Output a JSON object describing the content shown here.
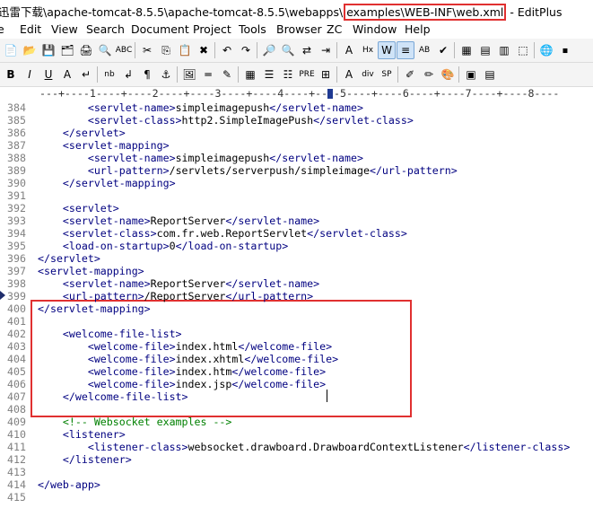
{
  "window": {
    "title_prefix": "迅雷下载\\apache-tomcat-8.5.5\\apache-tomcat-8.5.5\\webapps\\",
    "title_highlight": "examples\\WEB-INF\\web.xml",
    "title_suffix": " - EditPlus"
  },
  "menu": [
    "e",
    "Edit",
    "View",
    "Search",
    "Document",
    "Project",
    "Tools",
    "Browser",
    "ZC",
    "Window",
    "Help"
  ],
  "toolbar1": [
    {
      "name": "new-file-icon",
      "glyph": "📄"
    },
    {
      "name": "open-file-icon",
      "glyph": "📂"
    },
    {
      "name": "save-icon",
      "glyph": "💾"
    },
    {
      "name": "save-all-icon",
      "glyph": "🗂"
    },
    {
      "name": "print-icon",
      "glyph": "🖨"
    },
    {
      "name": "print-preview-icon",
      "glyph": "🔍"
    },
    {
      "name": "spell-check-icon",
      "glyph": "ABC"
    },
    {
      "name": "cut-icon",
      "glyph": "✂"
    },
    {
      "name": "copy-icon",
      "glyph": "⎘"
    },
    {
      "name": "paste-icon",
      "glyph": "📋"
    },
    {
      "name": "delete-icon",
      "glyph": "✖"
    },
    {
      "name": "undo-icon",
      "glyph": "↶"
    },
    {
      "name": "redo-icon",
      "glyph": "↷"
    },
    {
      "name": "find-icon",
      "glyph": "🔎"
    },
    {
      "name": "find-next-icon",
      "glyph": "🔍"
    },
    {
      "name": "replace-icon",
      "glyph": "⇄"
    },
    {
      "name": "indent-icon",
      "glyph": "⇥"
    },
    {
      "name": "font-icon",
      "glyph": "A"
    },
    {
      "name": "hex-icon",
      "glyph": "Hx"
    },
    {
      "name": "word-wrap-icon",
      "glyph": "W"
    },
    {
      "name": "line-number-icon",
      "glyph": "≡"
    },
    {
      "name": "ruler-icon",
      "glyph": "AB"
    },
    {
      "name": "spell-ok-icon",
      "glyph": "✔"
    },
    {
      "name": "directory-window-icon",
      "glyph": "▦"
    },
    {
      "name": "cliptext-icon",
      "glyph": "▤"
    },
    {
      "name": "output-window-icon",
      "glyph": "▥"
    },
    {
      "name": "fullscreen-icon",
      "glyph": "⬚"
    },
    {
      "name": "browser-icon",
      "glyph": "🌐"
    },
    {
      "name": "stop-icon",
      "glyph": "⏹"
    }
  ],
  "toolbar2": [
    {
      "name": "bold-icon",
      "glyph": "B"
    },
    {
      "name": "italic-icon",
      "glyph": "I"
    },
    {
      "name": "underline-icon",
      "glyph": "U"
    },
    {
      "name": "font-color-icon",
      "glyph": "A"
    },
    {
      "name": "line-break-icon",
      "glyph": "↵"
    },
    {
      "name": "nbsp-icon",
      "glyph": "nb"
    },
    {
      "name": "return-icon",
      "glyph": "↲"
    },
    {
      "name": "paragraph-icon",
      "glyph": "¶"
    },
    {
      "name": "anchor-icon",
      "glyph": "⚓"
    },
    {
      "name": "image-icon",
      "glyph": "🖼"
    },
    {
      "name": "horizontal-rule-icon",
      "glyph": "═"
    },
    {
      "name": "comment-icon",
      "glyph": "✎"
    },
    {
      "name": "table-icon",
      "glyph": "▦"
    },
    {
      "name": "form-icon",
      "glyph": "☰"
    },
    {
      "name": "list-icon",
      "glyph": "☷"
    },
    {
      "name": "pre-icon",
      "glyph": "PRE"
    },
    {
      "name": "table-wizard-icon",
      "glyph": "⊞"
    },
    {
      "name": "text-color-icon",
      "glyph": "A"
    },
    {
      "name": "div-icon",
      "glyph": "div"
    },
    {
      "name": "span-icon",
      "glyph": "SP"
    },
    {
      "name": "edit-icon",
      "glyph": "✐"
    },
    {
      "name": "pencil-icon",
      "glyph": "✏"
    },
    {
      "name": "color-picker-icon",
      "glyph": "🎨"
    },
    {
      "name": "view-browser-icon",
      "glyph": "▣"
    },
    {
      "name": "cliptext-panel-icon",
      "glyph": "▤"
    }
  ],
  "ruler": "---+----1----+----2----+----3----+----4----+----5----+----6----+----7----+----8----",
  "lines": [
    {
      "n": "384",
      "seg": [
        [
          "t",
          "        <servlet-name>"
        ],
        [
          "x",
          "simpleimagepush"
        ],
        [
          "t",
          "</servlet-name>"
        ]
      ]
    },
    {
      "n": "385",
      "seg": [
        [
          "t",
          "        <servlet-class>"
        ],
        [
          "x",
          "http2.SimpleImagePush"
        ],
        [
          "t",
          "</servlet-class>"
        ]
      ]
    },
    {
      "n": "386",
      "seg": [
        [
          "t",
          "    </servlet>"
        ]
      ]
    },
    {
      "n": "387",
      "seg": [
        [
          "t",
          "    <servlet-mapping>"
        ]
      ]
    },
    {
      "n": "388",
      "seg": [
        [
          "t",
          "        <servlet-name>"
        ],
        [
          "x",
          "simpleimagepush"
        ],
        [
          "t",
          "</servlet-name>"
        ]
      ]
    },
    {
      "n": "389",
      "seg": [
        [
          "t",
          "        <url-pattern>"
        ],
        [
          "x",
          "/servlets/serverpush/simpleimage"
        ],
        [
          "t",
          "</url-pattern>"
        ]
      ]
    },
    {
      "n": "390",
      "seg": [
        [
          "t",
          "    </servlet-mapping>"
        ]
      ]
    },
    {
      "n": "391",
      "seg": []
    },
    {
      "n": "392",
      "seg": [
        [
          "t",
          "    <servlet>"
        ]
      ]
    },
    {
      "n": "393",
      "seg": [
        [
          "t",
          "    <servlet-name>"
        ],
        [
          "x",
          "ReportServer"
        ],
        [
          "t",
          "</servlet-name>"
        ]
      ]
    },
    {
      "n": "394",
      "seg": [
        [
          "t",
          "    <servlet-class>"
        ],
        [
          "x",
          "com.fr.web.ReportServlet"
        ],
        [
          "t",
          "</servlet-class>"
        ]
      ]
    },
    {
      "n": "395",
      "seg": [
        [
          "t",
          "    <load-on-startup>"
        ],
        [
          "x",
          "0"
        ],
        [
          "t",
          "</load-on-startup>"
        ]
      ]
    },
    {
      "n": "396",
      "seg": [
        [
          "t",
          "</servlet>"
        ]
      ]
    },
    {
      "n": "397",
      "seg": [
        [
          "t",
          "<servlet-mapping>"
        ]
      ]
    },
    {
      "n": "398",
      "seg": [
        [
          "t",
          "    <servlet-name>"
        ],
        [
          "x",
          "ReportServer"
        ],
        [
          "t",
          "</servlet-name>"
        ]
      ]
    },
    {
      "n": "399",
      "seg": [
        [
          "t",
          "    <url-pattern>"
        ],
        [
          "x",
          "/ReportServer"
        ],
        [
          "t",
          "</url-pattern>"
        ]
      ],
      "marker": true
    },
    {
      "n": "400",
      "seg": [
        [
          "t",
          "</servlet-mapping>"
        ]
      ]
    },
    {
      "n": "401",
      "seg": []
    },
    {
      "n": "402",
      "seg": [
        [
          "t",
          "    <welcome-file-list>"
        ]
      ]
    },
    {
      "n": "403",
      "seg": [
        [
          "t",
          "        <welcome-file>"
        ],
        [
          "x",
          "index.html"
        ],
        [
          "t",
          "</welcome-file>"
        ]
      ]
    },
    {
      "n": "404",
      "seg": [
        [
          "t",
          "        <welcome-file>"
        ],
        [
          "x",
          "index.xhtml"
        ],
        [
          "t",
          "</welcome-file>"
        ]
      ]
    },
    {
      "n": "405",
      "seg": [
        [
          "t",
          "        <welcome-file>"
        ],
        [
          "x",
          "index.htm"
        ],
        [
          "t",
          "</welcome-file>"
        ]
      ]
    },
    {
      "n": "406",
      "seg": [
        [
          "t",
          "        <welcome-file>"
        ],
        [
          "x",
          "index.jsp"
        ],
        [
          "t",
          "</welcome-file>"
        ]
      ]
    },
    {
      "n": "407",
      "seg": [
        [
          "t",
          "    </welcome-file-list>"
        ]
      ]
    },
    {
      "n": "408",
      "seg": []
    },
    {
      "n": "409",
      "seg": [
        [
          "c",
          "    <!-- Websocket examples -->"
        ]
      ]
    },
    {
      "n": "410",
      "seg": [
        [
          "t",
          "    <listener>"
        ]
      ]
    },
    {
      "n": "411",
      "seg": [
        [
          "t",
          "        <listener-class>"
        ],
        [
          "x",
          "websocket.drawboard.DrawboardContextListener"
        ],
        [
          "t",
          "</listener-class>"
        ]
      ]
    },
    {
      "n": "412",
      "seg": [
        [
          "t",
          "    </listener>"
        ]
      ]
    },
    {
      "n": "413",
      "seg": []
    },
    {
      "n": "414",
      "seg": [
        [
          "t",
          "</web-app>"
        ]
      ]
    },
    {
      "n": "415",
      "seg": []
    }
  ],
  "colors": {
    "tag": "#000080",
    "comment": "#008000",
    "highlight_box": "#e03030",
    "line_number": "#808080"
  }
}
